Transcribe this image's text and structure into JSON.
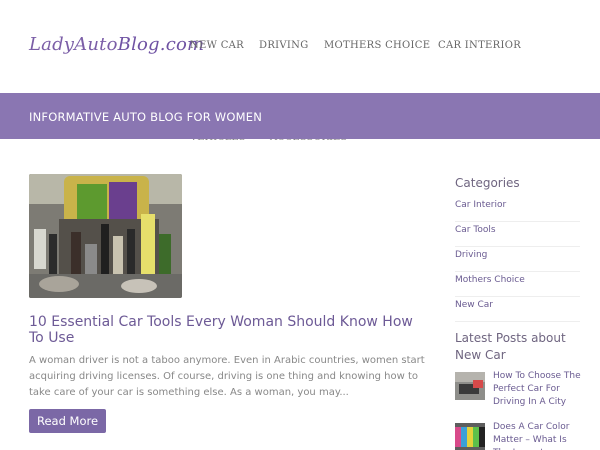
{
  "header": {
    "logo_part1": "LadyAuto",
    "logo_part2": "Blog.com",
    "nav": [
      "NEW CAR",
      "DRIVING",
      "MOTHERS CHOICE",
      "CAR INTERIOR"
    ],
    "nav_overflow": [
      "VEHICLES",
      "ACCESSORIES"
    ]
  },
  "banner": {
    "tagline": "INFORMATIVE AUTO BLOG FOR WOMEN"
  },
  "post": {
    "title": "10 Essential Car Tools Every Woman Should Know How To Use",
    "excerpt": "A woman driver is not a taboo anymore. Even in Arabic countries, women start acquiring driving licenses. Of course, driving is one thing and knowing how to take care of your car is something else. As a woman, you may...",
    "read_more": "Read More"
  },
  "sidebar": {
    "categories_title": "Categories",
    "categories": [
      "Car Interior",
      "Car Tools",
      "Driving",
      "Mothers Choice",
      "New Car"
    ],
    "latest_title": "Latest Posts about New Car",
    "latest_posts": [
      "How To Choose The Perfect Car For Driving In A City",
      "Does A Car Color Matter – What Is The Impact..."
    ]
  },
  "colors": {
    "accent": "#8a76b2",
    "button": "#7b68a6",
    "link": "#6a5b91"
  }
}
